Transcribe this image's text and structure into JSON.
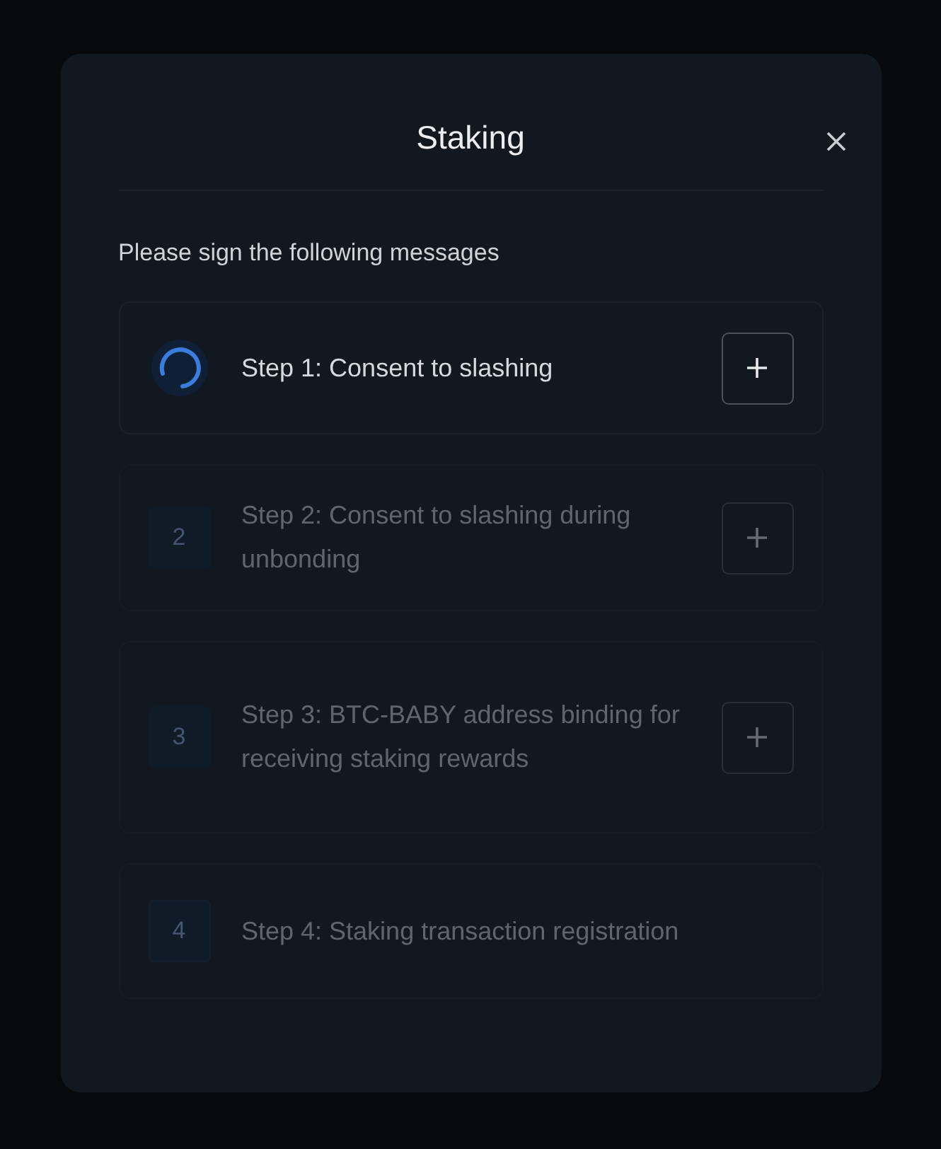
{
  "dialog": {
    "title": "Staking",
    "intro": "Please sign the following messages",
    "steps": [
      {
        "kind": "loading",
        "label": "Step 1: Consent to slashing",
        "disabled": false,
        "expandable": true
      },
      {
        "kind": "number",
        "number": "2",
        "label": "Step 2: Consent to slashing during unbonding",
        "disabled": true,
        "expandable": true
      },
      {
        "kind": "number",
        "number": "3",
        "label": "Step 3: BTC-BABY address binding for receiving staking rewards",
        "disabled": true,
        "expandable": true
      },
      {
        "kind": "number",
        "number": "4",
        "label": "Step 4: Staking transaction registration",
        "disabled": true,
        "expandable": false
      }
    ]
  }
}
